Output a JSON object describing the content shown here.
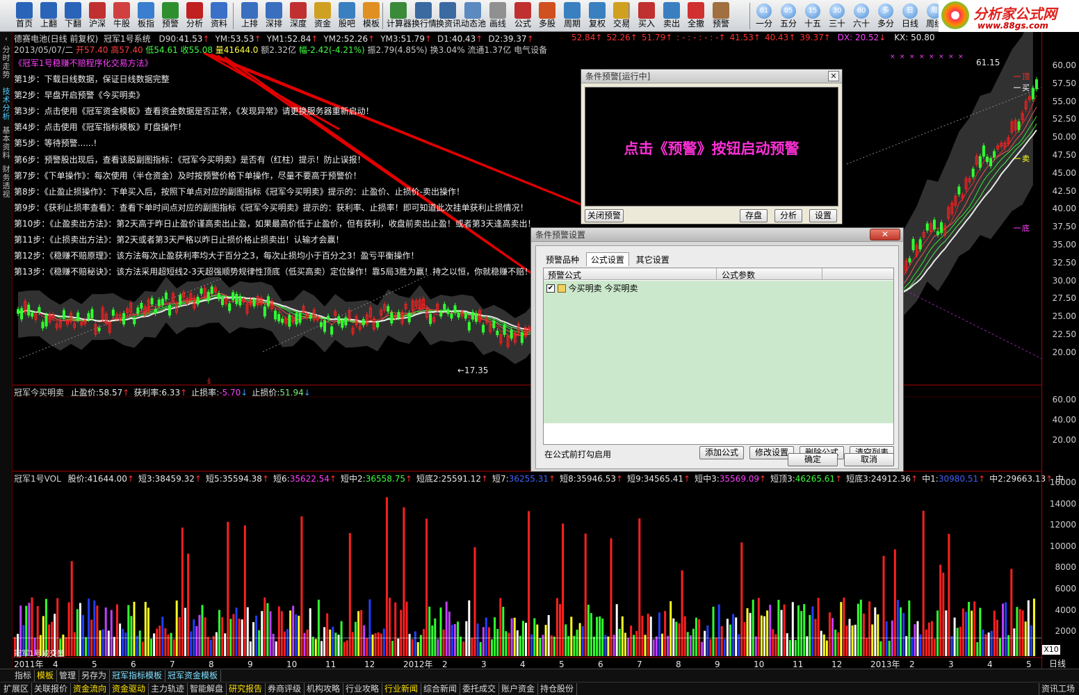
{
  "toolbar": {
    "left_buttons": [
      {
        "label": "首页",
        "icon": "home-icon"
      },
      {
        "label": "上翻",
        "icon": "arrow-up-icon"
      },
      {
        "label": "下翻",
        "icon": "arrow-down-icon"
      },
      {
        "label": "沪深",
        "icon": "yuan-icon"
      },
      {
        "label": "牛股",
        "icon": "f6-icon"
      },
      {
        "label": "板指",
        "icon": "globe-icon"
      },
      {
        "label": "预警",
        "icon": "chart-line-icon"
      },
      {
        "label": "分析",
        "icon": "chart-red-icon"
      },
      {
        "label": "资料",
        "icon": "document-icon"
      }
    ],
    "mid_buttons": [
      {
        "label": "上排",
        "icon": "bars-icon"
      },
      {
        "label": "深排",
        "icon": "bars-icon"
      },
      {
        "label": "深度",
        "icon": "f9-icon"
      },
      {
        "label": "资金",
        "icon": "coins-icon"
      },
      {
        "label": "股吧",
        "icon": "person-icon"
      },
      {
        "label": "模板",
        "icon": "l2-icon"
      }
    ],
    "right_buttons": [
      {
        "label": "计算器",
        "icon": "calculator-icon"
      },
      {
        "label": "换行情",
        "icon": "monitor-icon"
      },
      {
        "label": "换资讯",
        "icon": "monitor-icon"
      },
      {
        "label": "动态池",
        "icon": "pool-icon"
      },
      {
        "label": "画线",
        "icon": "pencil-icon"
      },
      {
        "label": "公式",
        "icon": "formula-icon"
      },
      {
        "label": "多股",
        "icon": "grid-icon"
      },
      {
        "label": "周期",
        "icon": "clock-icon"
      },
      {
        "label": "复权",
        "icon": "check-icon"
      },
      {
        "label": "交易",
        "icon": "trade-icon"
      },
      {
        "label": "买入",
        "icon": "buy-icon"
      },
      {
        "label": "卖出",
        "icon": "sell-icon"
      },
      {
        "label": "全撤",
        "icon": "cancel-icon"
      },
      {
        "label": "预警",
        "icon": "alarm-grid-icon"
      }
    ],
    "period_buttons": [
      {
        "num": "01",
        "label": "一分"
      },
      {
        "num": "05",
        "label": "五分"
      },
      {
        "num": "15",
        "label": "十五"
      },
      {
        "num": "30",
        "label": "三十"
      },
      {
        "num": "60",
        "label": "六十"
      },
      {
        "num": "多",
        "label": "多分"
      },
      {
        "num": "日",
        "label": "日线"
      },
      {
        "num": "周",
        "label": "周线"
      }
    ],
    "logo_title": "分析家公式网",
    "logo_url": "www.88gs.com"
  },
  "left_tabs": [
    "分时走势",
    "技术分析",
    "基本资料",
    "财务透视"
  ],
  "header": {
    "stock": "德赛电池(日线 前复权)",
    "system": "冠军1号系统",
    "values": [
      {
        "k": "D90:",
        "v": "41.53",
        "color": "#e8e8e8"
      },
      {
        "k": "YM:",
        "v": "53.53",
        "color": "#e8e8e8"
      },
      {
        "k": "YM1:",
        "v": "52.84",
        "color": "#e8e8e8"
      },
      {
        "k": "YM2:",
        "v": "52.26",
        "color": "#e8e8e8"
      },
      {
        "k": "YM3:",
        "v": "51.79",
        "color": "#e8e8e8"
      },
      {
        "k": "D1:",
        "v": "40.43",
        "color": "#e8e8e8"
      },
      {
        "k": "D2:",
        "v": "39.37",
        "color": "#e8e8e8"
      }
    ],
    "right_values": [
      "52.84",
      "52.26",
      "51.79",
      ": - : - : - : -",
      "41.53",
      "40.43",
      "39.37"
    ],
    "dx": "DX: 20.52",
    "kx": "KX: 50.80",
    "date_line": {
      "date": "2013/05/07/二",
      "open": "开57.40",
      "high": "高57.40",
      "low": "低54.61",
      "close": "收55.08",
      "vol": "量41644.0",
      "amount": "额2.32亿",
      "change": "幅-2.42(-4.21%)",
      "amplitude": "振2.79(4.85%)",
      "turnover": "换3.04%",
      "float": "流通1.37亿",
      "sector": "电气设备"
    }
  },
  "guide": {
    "title": "《冠军1号稳赚不赔程序化交易方法》",
    "steps": [
      "第1步：下载日线数据，保证日线数据完整",
      "第2步：早盘开启预警《今买明卖》",
      "第3步：点击使用《冠军资金模板》查看资金数据是否正常，《发现异常》请更换服务器重新启动！",
      "第4步：点击使用《冠军指标模板》盯盘操作！",
      "第5步：等待预警......!",
      "第6步：预警股出现后，查看该股副图指标：《冠军今买明卖》是否有（红柱）提示！防止误报！",
      "第7步：《下单操作》：每次使用（半仓资金）及时按预警价格下单操作，尽量不要高于预警价！",
      "第8步：《止盈止损操作》：下单买入后，按照下单点对应的副图指标《冠军今买明卖》提示的：止盈价、止损价-卖出操作！",
      "第9步：《获利止损率查看》：查看下单时间点对应的副图指标《冠军今买明卖》提示的：获利率、止损率！即可知道此次挂单获利止损情况！",
      "第10步：《止盈卖出方法》：第2天高于昨日止盈价谨高卖出止盈，如果最高价低于止盈价，但有获利，收盘前卖出止盈！或者第3天逢高卖出！",
      "第11步：《止损卖出方法》：第2天或者第3天严格以昨日止损价格止损卖出！认输才会赢！",
      "第12步：《稳赚不赔原理》：该方法每次止盈获利率均大于百分之3，每次止损均小于百分之3！盈亏平衡操作！",
      "第13步：《稳赚不赔秘诀》：该方法采用超短线2-3天超强顺势规律性顶底（低买高卖）定位操作！靠5局3胜为赢！持之以恒，你就稳赚不赔！"
    ]
  },
  "main_chart": {
    "low_label": "17.35",
    "high_label": "61.15",
    "right_markers": [
      "顶",
      "买",
      "卖",
      "底"
    ],
    "y_ticks": [
      "60.00",
      "57.50",
      "55.00",
      "52.50",
      "50.00",
      "47.50",
      "45.00",
      "42.50",
      "40.00",
      "37.50",
      "35.00",
      "32.50",
      "30.00",
      "27.50",
      "25.00",
      "22.50",
      "20.00"
    ]
  },
  "sub1": {
    "name": "冠军今买明卖",
    "items": [
      {
        "k": "止盈价:",
        "v": "58.57",
        "color": "#e8e8e8",
        "arrow": "↑"
      },
      {
        "k": "获利率:",
        "v": "6.33",
        "color": "#e8e8e8",
        "arrow": "↑"
      },
      {
        "k": "止损率:",
        "v": "-5.70",
        "color": "#ff40ff",
        "arrow": "↓"
      },
      {
        "k": "止损价:",
        "v": "51.94",
        "color": "#7cf07c",
        "arrow": "↓"
      }
    ],
    "y_ticks": [
      "60.00",
      "40.00",
      "20.00"
    ]
  },
  "vol": {
    "name": "冠军1号VOL",
    "items": [
      {
        "k": "股价:",
        "v": "41644.00",
        "color": "#e8e8e8"
      },
      {
        "k": "短3:",
        "v": "38459.32",
        "color": "#e8e8e8"
      },
      {
        "k": "短5:",
        "v": "35594.38",
        "color": "#e8e8e8"
      },
      {
        "k": "短6:",
        "v": "35622.54",
        "color": "#ff40ff"
      },
      {
        "k": "短中2:",
        "v": "36558.75",
        "color": "#40ff40"
      },
      {
        "k": "短底2:",
        "v": "25591.12",
        "color": "#e8e8e8"
      },
      {
        "k": "短7:",
        "v": "36255.31",
        "color": "#4060ff"
      },
      {
        "k": "短8:",
        "v": "35946.53",
        "color": "#e8e8e8"
      },
      {
        "k": "短9:",
        "v": "34565.41",
        "color": "#e8e8e8"
      },
      {
        "k": "短中3:",
        "v": "35569.09",
        "color": "#ff40ff"
      },
      {
        "k": "短顶3:",
        "v": "46265.61",
        "color": "#40ff40"
      },
      {
        "k": "短底3:",
        "v": "24912.36",
        "color": "#e8e8e8"
      },
      {
        "k": "中1:",
        "v": "30980.51",
        "color": "#4060ff"
      },
      {
        "k": "中2:",
        "v": "29663.13",
        "color": "#e8e8e8"
      }
    ],
    "tail": "中",
    "y_ticks": [
      "16000",
      "14000",
      "12000",
      "10000",
      "8000",
      "6000",
      "4000",
      "2000"
    ],
    "x10": "X10",
    "footnote": "冠军1号成交量"
  },
  "xaxis": {
    "labels": [
      "2011年",
      "4",
      "5",
      "6",
      "7",
      "8",
      "9",
      "10",
      "11",
      "12",
      "2012年",
      "2",
      "3",
      "4",
      "5",
      "6",
      "7",
      "8",
      "9",
      "10",
      "11",
      "12",
      "2013年",
      "2",
      "3",
      "4",
      "5"
    ],
    "period": "日线"
  },
  "dialog_alert": {
    "title": "条件预警[运行中]",
    "message": "点击《预警》按钮启动预警",
    "btn_close": "关闭预警",
    "btn_save": "存盘",
    "btn_analyze": "分析",
    "btn_settings": "设置",
    "message_color": "#ff30d8"
  },
  "dialog_settings": {
    "title": "条件预警设置",
    "tabs": [
      "预警品种",
      "公式设置",
      "其它设置"
    ],
    "columns": [
      "预警公式",
      "公式参数"
    ],
    "rows": [
      {
        "formula": "今买明卖  今买明卖",
        "params": "",
        "checked": true
      }
    ],
    "hint": "在公式前打勾启用",
    "btn_add": "添加公式",
    "btn_modify": "修改设置",
    "btn_delete": "删除公式",
    "btn_clear": "清空列表",
    "btn_ok": "确定",
    "btn_cancel": "取消"
  },
  "bottom_tabs_1": {
    "items": [
      "指标",
      "模板",
      "管理",
      "另存为",
      "冠军指标模板",
      "冠军资金模板"
    ]
  },
  "bottom_tabs_2": {
    "items": [
      "扩展区",
      "关联报价",
      "资金流向",
      "资金驱动",
      "主力轨迹",
      "智能解盘",
      "研究报告",
      "券商评级",
      "机构攻略",
      "行业攻略",
      "行业新闻",
      "综合新闻",
      "委托成交",
      "账户资金",
      "持仓股份"
    ],
    "right": "资讯工场"
  },
  "colors": {
    "up": "#ff2020",
    "down": "#30ff30",
    "accent_yellow": "#ffff20",
    "accent_purple": "#c040ff",
    "frame": "#b00000"
  }
}
